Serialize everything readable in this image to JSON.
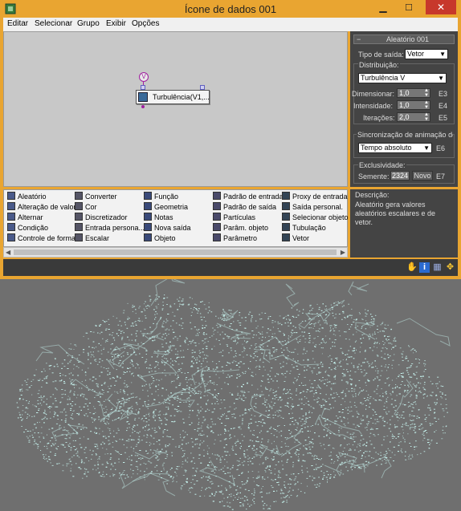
{
  "window": {
    "title": "Ícone de dados 001"
  },
  "menu": [
    "Editar",
    "Selecionar",
    "Grupo",
    "Exibir",
    "Opções"
  ],
  "node": {
    "input_label": "V",
    "label": "Turbulência(V1,..."
  },
  "palette": {
    "col1": [
      "Aleatório",
      "Alteração de valor",
      "Alternar",
      "Condição",
      "Controle de forma"
    ],
    "col2": [
      "Converter",
      "Cor",
      "Discretizador",
      "Entrada persona...",
      "Escalar"
    ],
    "col3": [
      "Função",
      "Geometria",
      "Notas",
      "Nova saída",
      "Objeto"
    ],
    "col4": [
      "Padrão de entrada",
      "Padrão de saída",
      "Partículas",
      "Parâm. objeto",
      "Parâmetro"
    ],
    "col5": [
      "Proxy de entrada",
      "Saída personal.",
      "Selecionar objeto",
      "Tubulação",
      "Vetor"
    ]
  },
  "rollout": {
    "title": "Aleatório 001",
    "output_type_label": "Tipo de saída:",
    "output_type_value": "Vetor",
    "distribution_label": "Distribuição:",
    "distribution_value": "Turbulência V",
    "dimension_label": "Dimensionar:",
    "dimension_value": "1,0",
    "dimension_key": "E3",
    "intensity_label": "Intensidade:",
    "intensity_value": "1,0",
    "intensity_key": "E4",
    "iterations_label": "Iterações:",
    "iterations_value": "2,0",
    "iterations_key": "E5",
    "sync_label": "Sincronização de animação de",
    "sync_value": "Tempo absoluto",
    "sync_key": "E6",
    "exclusivity_label": "Exclusividade:",
    "seed_label": "Semente:",
    "seed_value": "2324",
    "new_label": "Novo",
    "seed_key": "E7"
  },
  "description": {
    "title": "Descrição:",
    "text": "Aleatório gera valores aleatórios escalares e de vetor."
  },
  "colors": {
    "titlebar": "#e9a531",
    "close": "#c7382b",
    "noise": "#c8f5f0"
  }
}
